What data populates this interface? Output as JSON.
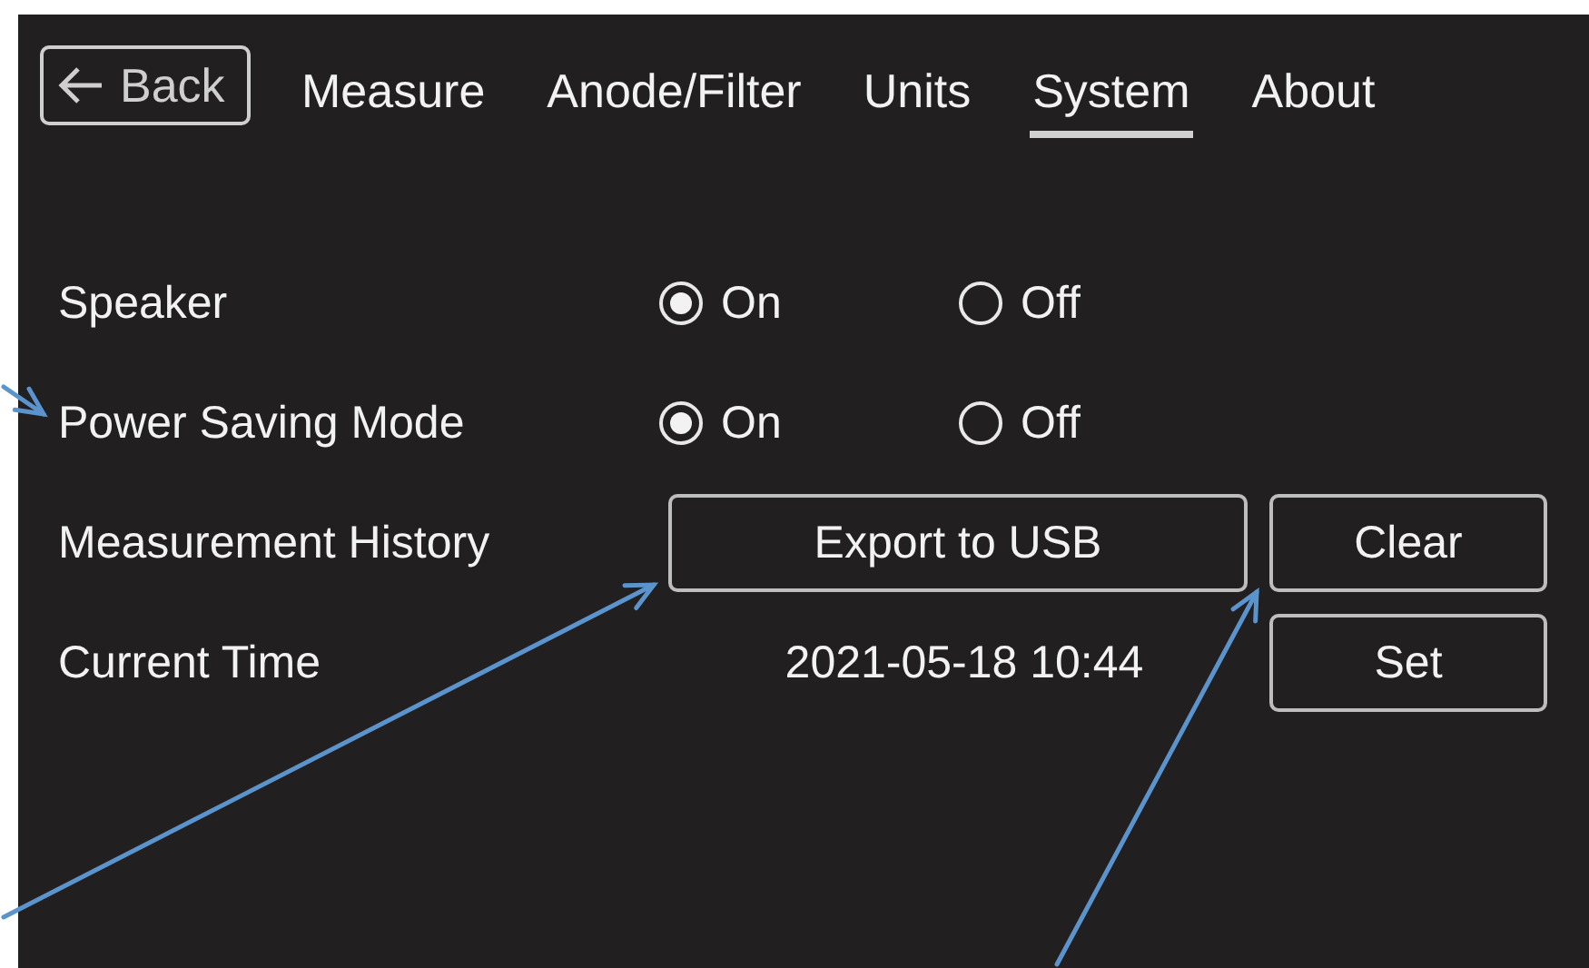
{
  "back_button": {
    "label": "Back"
  },
  "tabs": [
    {
      "label": "Measure",
      "selected": false
    },
    {
      "label": "Anode/Filter",
      "selected": false
    },
    {
      "label": "Units",
      "selected": false
    },
    {
      "label": "System",
      "selected": true
    },
    {
      "label": "About",
      "selected": false
    }
  ],
  "settings": [
    {
      "kind": "radio",
      "label": "Speaker",
      "options": [
        {
          "label": "On",
          "selected": true
        },
        {
          "label": "Off",
          "selected": false
        }
      ]
    },
    {
      "kind": "radio",
      "label": "Power Saving Mode",
      "options": [
        {
          "label": "On",
          "selected": true
        },
        {
          "label": "Off",
          "selected": false
        }
      ]
    },
    {
      "kind": "buttons",
      "label": "Measurement History",
      "buttons": [
        "Export to USB",
        "Clear"
      ]
    },
    {
      "kind": "time",
      "label": "Current Time",
      "value": "2021-05-18 10:44",
      "buttons": [
        "Set"
      ]
    }
  ]
}
